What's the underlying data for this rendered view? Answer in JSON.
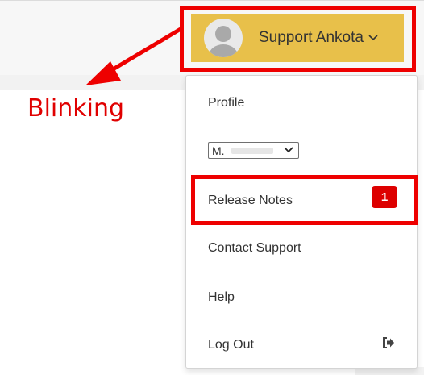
{
  "user_menu": {
    "user_name": "Support Ankota",
    "avatar_icon": "user-avatar-icon",
    "chevron_icon": "chevron-down-icon",
    "button_color": "#e8c04a"
  },
  "dropdown": {
    "profile_label": "Profile",
    "select_value": "M.",
    "release_notes_label": "Release Notes",
    "release_notes_badge": "1",
    "contact_support_label": "Contact Support",
    "help_label": "Help",
    "logout_label": "Log Out",
    "logout_icon": "sign-out-icon",
    "badge_color": "#dd0000"
  },
  "annotation": {
    "text": "Blinking",
    "color": "#ee0000"
  }
}
